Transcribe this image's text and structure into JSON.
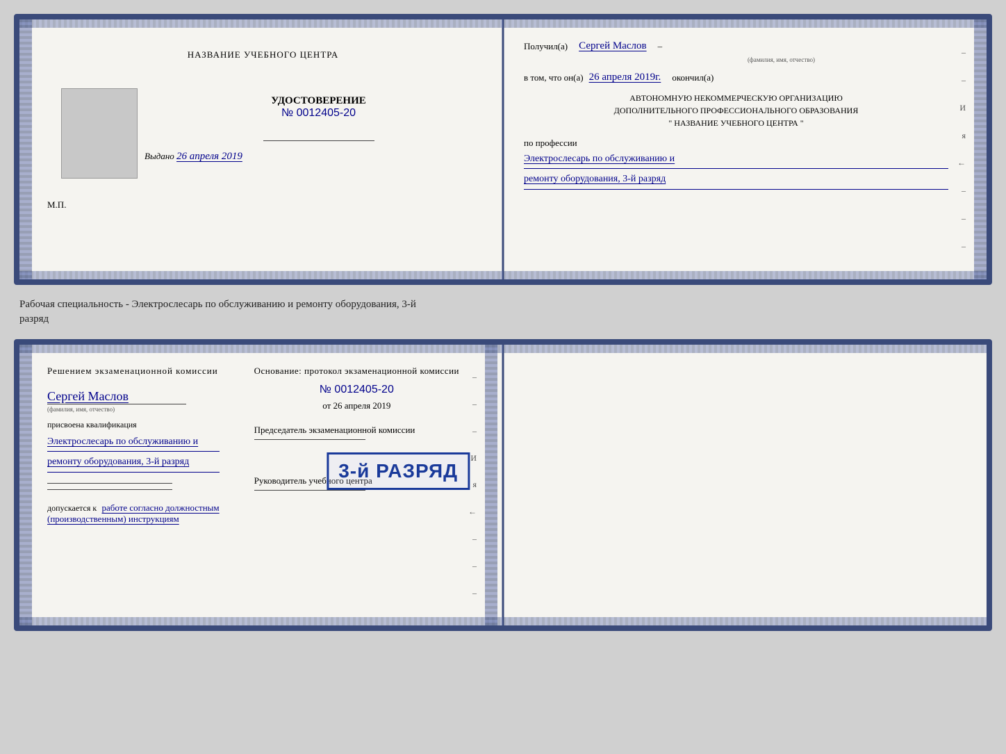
{
  "cert1": {
    "left": {
      "org_title": "НАЗВАНИЕ УЧЕБНОГО ЦЕНТРА",
      "doc_title": "УДОСТОВЕРЕНИЕ",
      "doc_number_prefix": "№",
      "doc_number": "0012405-20",
      "issued_label": "Выдано",
      "issued_date": "26 апреля 2019",
      "mp_label": "М.П."
    },
    "right": {
      "received_label": "Получил(а)",
      "recipient_name": "Сергей Маслов",
      "recipient_subtitle": "(фамилия, имя, отчество)",
      "dash": "–",
      "in_that_label": "в том, что он(а)",
      "completion_date": "26 апреля 2019г.",
      "completed_label": "окончил(а)",
      "org_line1": "АВТОНОМНУЮ НЕКОММЕРЧЕСКУЮ ОРГАНИЗАЦИЮ",
      "org_line2": "ДОПОЛНИТЕЛЬНОГО ПРОФЕССИОНАЛЬНОГО ОБРАЗОВАНИЯ",
      "org_name": "\" НАЗВАНИЕ УЧЕБНОГО ЦЕНТРА \"",
      "profession_label": "по профессии",
      "profession_line1": "Электрослесарь по обслуживанию и",
      "profession_line2": "ремонту оборудования, 3-й разряд"
    }
  },
  "between_label": {
    "line1": "Рабочая специальность - Электрослесарь по обслуживанию и ремонту оборудования, 3-й",
    "line2": "разряд"
  },
  "cert2": {
    "left": {
      "commission_title": "Решением экзаменационной комиссии",
      "person_name": "Сергей Маслов",
      "person_subtitle": "(фамилия, имя, отчество)",
      "assigned_label": "присвоена квалификация",
      "qualification_line1": "Электрослесарь по обслуживанию и",
      "qualification_line2": "ремонту оборудования, 3-й разряд",
      "admitted_label": "допускается к",
      "admitted_value": "работе согласно должностным",
      "admitted_value2": "(производственным) инструкциям"
    },
    "right": {
      "basis_label": "Основание: протокол экзаменационной комиссии",
      "number_prefix": "№",
      "number": "0012405-20",
      "date_prefix": "от",
      "date": "26 апреля 2019",
      "chairman_role": "Председатель экзаменационной комиссии",
      "director_role": "Руководитель учебного центра"
    },
    "stamp": {
      "text": "3-й РАЗРЯД"
    }
  },
  "side_letters": {
    "letter_i": "И",
    "letter_ya": "я",
    "arrow": "←"
  }
}
